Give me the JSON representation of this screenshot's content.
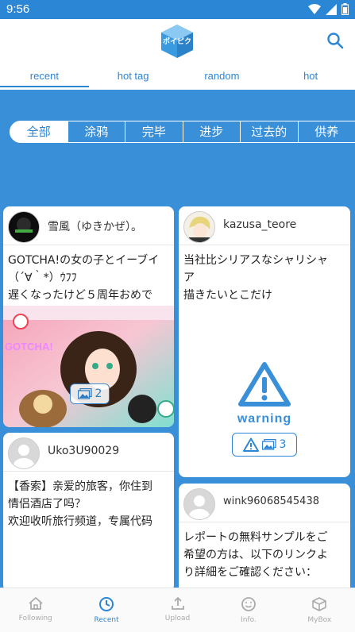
{
  "status_bar": {
    "time": "9:56"
  },
  "header": {
    "logo_text": "ポイピク"
  },
  "tabs": [
    {
      "label": "recent"
    },
    {
      "label": "hot tag"
    },
    {
      "label": "random"
    },
    {
      "label": "hot"
    }
  ],
  "categories": [
    {
      "label": "全部"
    },
    {
      "label": "涂鸦"
    },
    {
      "label": "完毕"
    },
    {
      "label": "进步"
    },
    {
      "label": "过去的"
    },
    {
      "label": "供养"
    }
  ],
  "posts": [
    {
      "username": "雪風（ゆきかぜ）。",
      "text_lines": [
        "GOTCHA!の女の子とイーブイ",
        "（´∀｀*）ｳﾌﾌ",
        "遅くなったけど５周年おめで"
      ],
      "image_label": "GOTCHA!",
      "count": "2"
    },
    {
      "username": "kazusa_teore",
      "text_lines": [
        "当社比シリアスなシャリシャ",
        "ア",
        "描きたいとこだけ"
      ],
      "warning_label": "warning",
      "count": "3"
    },
    {
      "username": "Uko3U90029",
      "text_lines": [
        "【香索】亲爱的旅客，你住到",
        "情侣酒店了吗？",
        "欢迎收听旅行频道，专属代码"
      ]
    },
    {
      "username": "wink96068545438",
      "text_lines": [
        "レポートの無料サンプルをご",
        "希望の方は、以下のリンクよ",
        "り詳細をご確認ください："
      ]
    }
  ],
  "bottom_nav": [
    {
      "label": "Following",
      "icon": "home-icon"
    },
    {
      "label": "Recent",
      "icon": "clock-icon"
    },
    {
      "label": "Upload",
      "icon": "upload-icon"
    },
    {
      "label": "Info.",
      "icon": "smile-icon"
    },
    {
      "label": "MyBox",
      "icon": "box-icon"
    }
  ]
}
